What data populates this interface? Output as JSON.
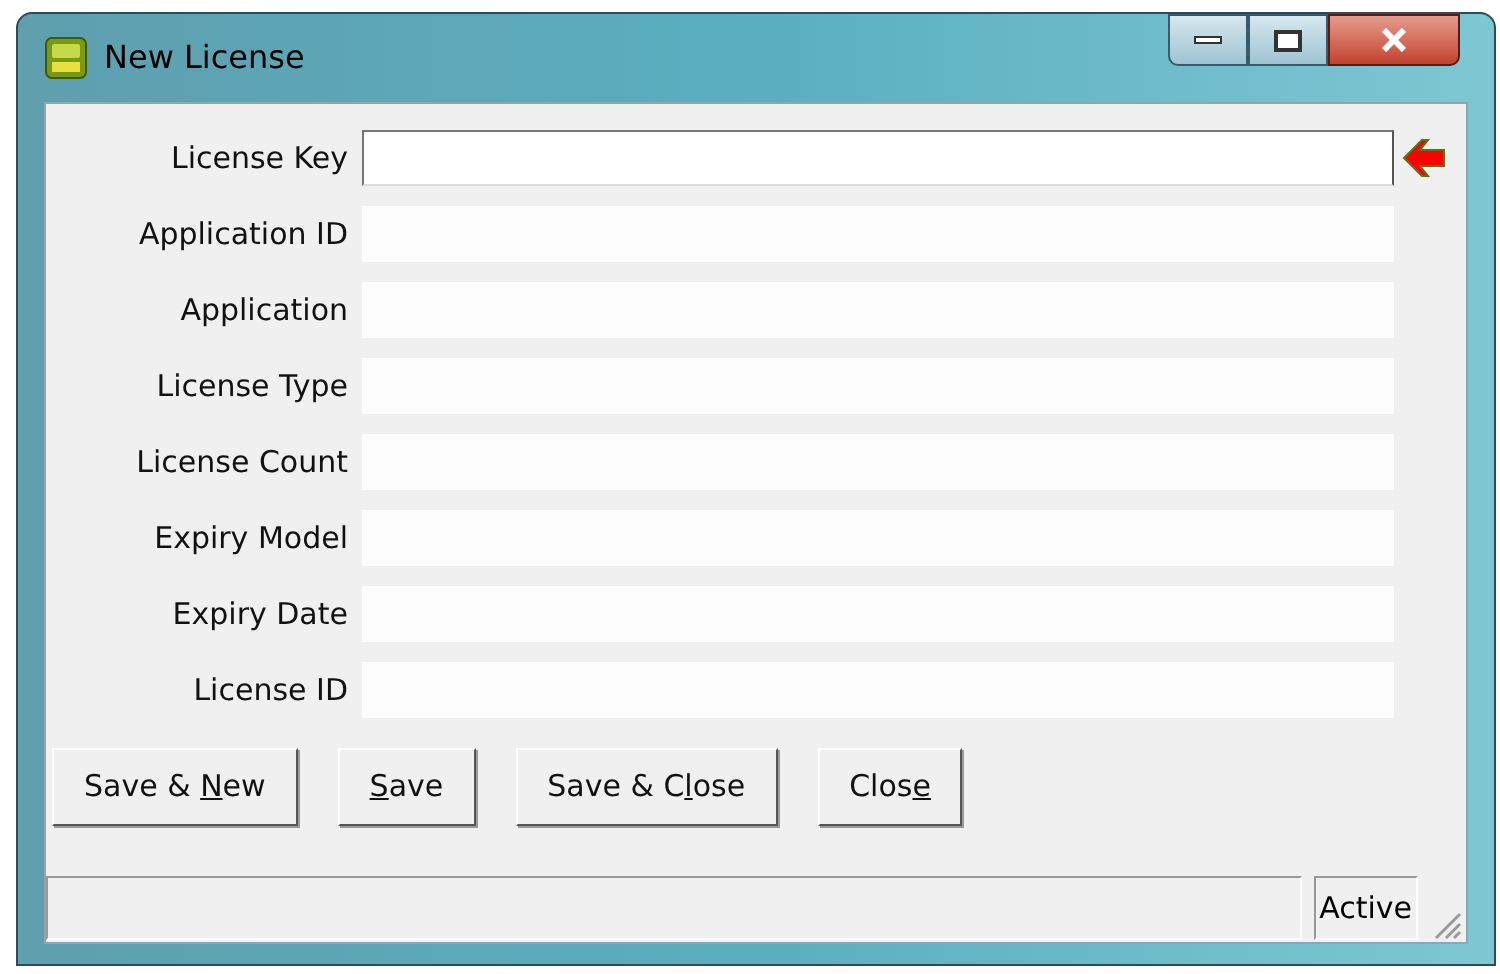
{
  "window": {
    "title": "New License"
  },
  "fields": [
    {
      "label": "License Key",
      "editable": true,
      "current": true
    },
    {
      "label": "Application ID",
      "editable": false,
      "current": false
    },
    {
      "label": "Application",
      "editable": false,
      "current": false
    },
    {
      "label": "License Type",
      "editable": false,
      "current": false
    },
    {
      "label": "License Count",
      "editable": false,
      "current": false
    },
    {
      "label": "Expiry Model",
      "editable": false,
      "current": false
    },
    {
      "label": "Expiry Date",
      "editable": false,
      "current": false
    },
    {
      "label": "License ID",
      "editable": false,
      "current": false
    }
  ],
  "buttons": [
    {
      "before": "Save & ",
      "key": "N",
      "after": "ew"
    },
    {
      "key": "S",
      "after": "ave"
    },
    {
      "before": "Save & C",
      "key": "l",
      "after": "ose"
    },
    {
      "before": "Clos",
      "key": "e"
    }
  ],
  "status_bar": {
    "status": "Active"
  }
}
